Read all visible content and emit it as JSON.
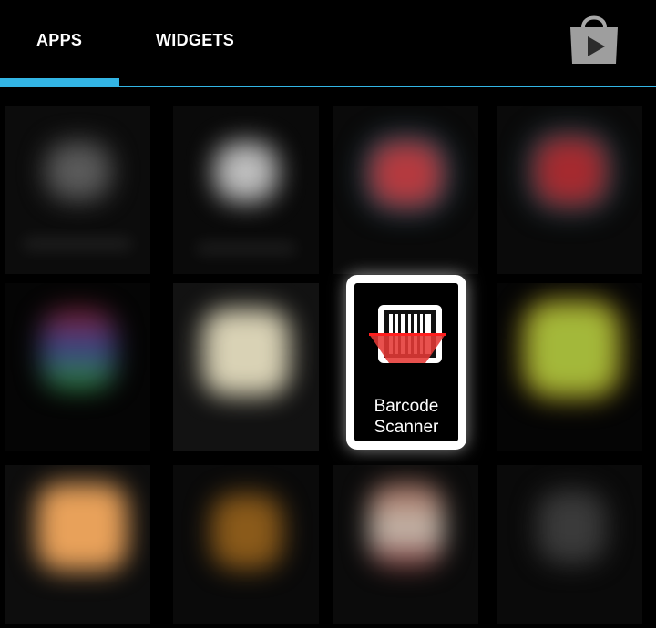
{
  "tabs": [
    {
      "label": "APPS",
      "selected": true
    },
    {
      "label": "WIDGETS",
      "selected": false
    }
  ],
  "store_button": {
    "icon": "play-store-icon"
  },
  "colors": {
    "accent": "#33b5e5",
    "background": "#000000",
    "focus_border": "#ffffff",
    "barcode_red": "#e53935"
  },
  "focused_app": {
    "label_line1": "Barcode",
    "label_line2": "Scanner",
    "icon": "barcode-scanner-icon"
  }
}
